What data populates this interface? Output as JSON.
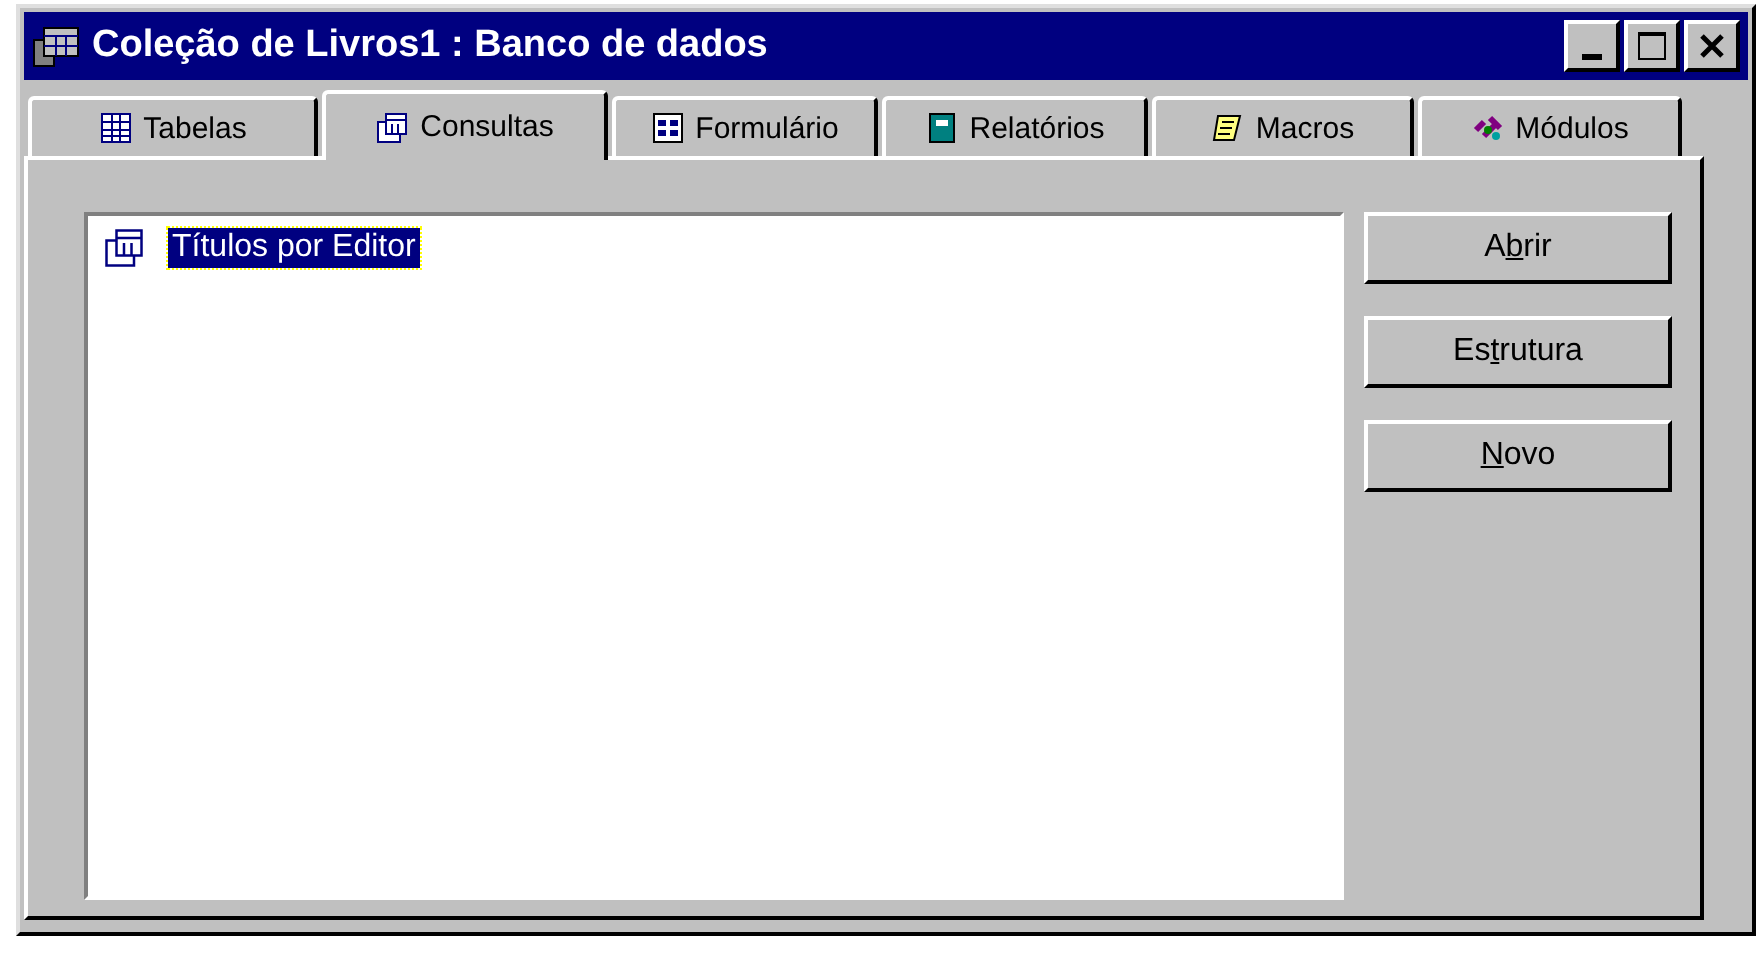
{
  "window": {
    "title": "Coleção de Livros1 : Banco de dados"
  },
  "tabs": [
    {
      "label": "Tabelas",
      "kind": "table",
      "selected": false
    },
    {
      "label": "Consultas",
      "kind": "query",
      "selected": true
    },
    {
      "label": "Formulário",
      "kind": "form",
      "selected": false
    },
    {
      "label": "Relatórios",
      "kind": "report",
      "selected": false
    },
    {
      "label": "Macros",
      "kind": "macro",
      "selected": false
    },
    {
      "label": "Módulos",
      "kind": "module",
      "selected": false
    }
  ],
  "items": [
    {
      "label": "Títulos por Editor",
      "selected": true
    }
  ],
  "buttons": [
    {
      "before": "A",
      "key": "b",
      "after": "rir"
    },
    {
      "before": "Es",
      "key": "t",
      "after": "rutura"
    },
    {
      "key": "N",
      "after": "ovo"
    }
  ]
}
